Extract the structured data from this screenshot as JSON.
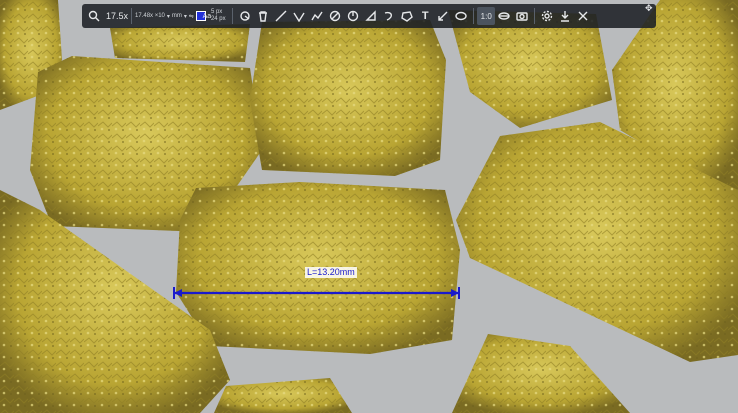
{
  "toolbar": {
    "magnification": "17.5x",
    "zoom_info": "17.48x ×10",
    "unit": "mm",
    "line_width_label": "5 px",
    "font_size_label": "24 px",
    "font_label": "Aa",
    "accent_color": "#2230d8",
    "tools": [
      {
        "name": "select-tool",
        "icon": "pointer-icon"
      },
      {
        "name": "delete-tool",
        "icon": "trash-icon"
      },
      {
        "name": "line-tool",
        "icon": "line-icon"
      },
      {
        "name": "angle-tool",
        "icon": "angle-icon"
      },
      {
        "name": "polyline-tool",
        "icon": "polyline-icon"
      },
      {
        "name": "circle-diameter-tool",
        "icon": "circle-slash-icon"
      },
      {
        "name": "arc-tool",
        "icon": "arc-icon"
      },
      {
        "name": "triangle-tool",
        "icon": "triangle-icon"
      },
      {
        "name": "curve-tool",
        "icon": "curve-icon"
      },
      {
        "name": "polygon-tool",
        "icon": "polygon-icon"
      },
      {
        "name": "text-tool",
        "icon": "text-icon",
        "glyph": "T"
      },
      {
        "name": "arrow-tool",
        "icon": "arrow-icon"
      },
      {
        "name": "ellipse-tool",
        "icon": "ellipse-icon"
      }
    ],
    "view_tools": [
      {
        "name": "one-to-one-button",
        "label": "1:0",
        "active": true
      },
      {
        "name": "fit-button",
        "icon": "fit-icon"
      },
      {
        "name": "camera-button",
        "icon": "camera-icon"
      }
    ],
    "settings_icon": "gear-icon",
    "export_icon": "download-icon",
    "close_icon": "close-icon"
  },
  "measurement": {
    "label": "L=13.20mm",
    "color": "#1a1acc"
  },
  "background_color": "#b9bbbd",
  "pellet_color": "#c6b63a"
}
